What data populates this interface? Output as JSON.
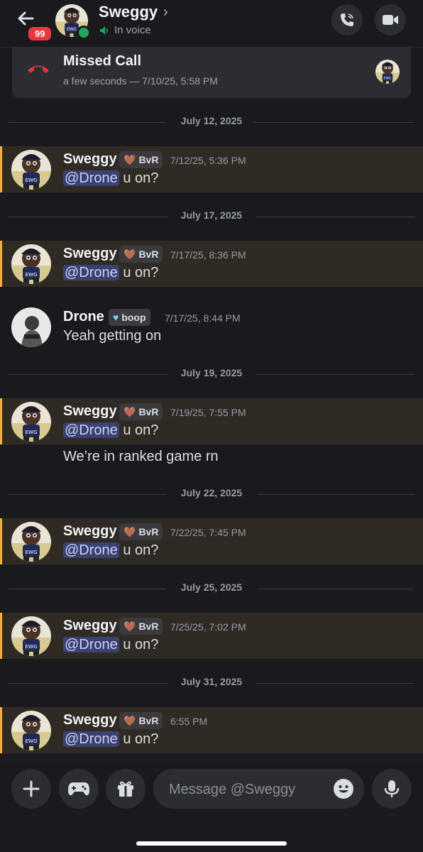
{
  "header": {
    "back_badge": "99",
    "name": "Sweggy",
    "chevron": "›",
    "status": "In voice",
    "icons": [
      "back-arrow-icon",
      "voice-call-icon",
      "video-call-icon",
      "speaker-icon"
    ]
  },
  "missed_call": {
    "title": "Missed Call",
    "subtitle": "a few seconds — 7/10/25, 5:58 PM",
    "icon": "hangup-phone-icon",
    "color": "#e5393e"
  },
  "dividers": [
    "July 12, 2025",
    "July 17, 2025",
    "July 19, 2025",
    "July 22, 2025",
    "July 25, 2025",
    "July 31, 2025"
  ],
  "messages": [
    {
      "author": "Sweggy",
      "tag": "BvR",
      "time": "7/12/25, 5:36 PM",
      "mention": "@Drone",
      "text": " u on?",
      "highlight": true
    },
    {
      "author": "Sweggy",
      "tag": "BvR",
      "time": "7/17/25, 8:36 PM",
      "mention": "@Drone",
      "text": " u on?",
      "highlight": true
    },
    {
      "author": "Drone",
      "tag": "boop",
      "time": "7/17/25, 8:44 PM",
      "mention": "",
      "text": "Yeah getting on",
      "highlight": false
    },
    {
      "author": "Sweggy",
      "tag": "BvR",
      "time": "7/19/25, 7:55 PM",
      "mention": "@Drone",
      "text": " u on?",
      "extra": "We’re in ranked game rn",
      "highlight": true
    },
    {
      "author": "Sweggy",
      "tag": "BvR",
      "time": "7/22/25, 7:45 PM",
      "mention": "@Drone",
      "text": " u on?",
      "highlight": true
    },
    {
      "author": "Sweggy",
      "tag": "BvR",
      "time": "7/25/25, 7:02 PM",
      "mention": "@Drone",
      "text": " u on?",
      "highlight": true
    },
    {
      "author": "Sweggy",
      "tag": "BvR",
      "time": "6:55 PM",
      "mention": "@Drone",
      "text": " u on?",
      "highlight": true
    }
  ],
  "composer": {
    "placeholder": "Message @Sweggy",
    "icons": [
      "plus-icon",
      "gamepad-icon",
      "gift-icon",
      "emoji-icon",
      "microphone-icon"
    ]
  },
  "colors": {
    "background": "#1a1a1e",
    "highlight_bg": "#2f2b24",
    "highlight_bar": "#f0b232",
    "mention_bg": "#3c4270",
    "online": "#23a55a"
  }
}
